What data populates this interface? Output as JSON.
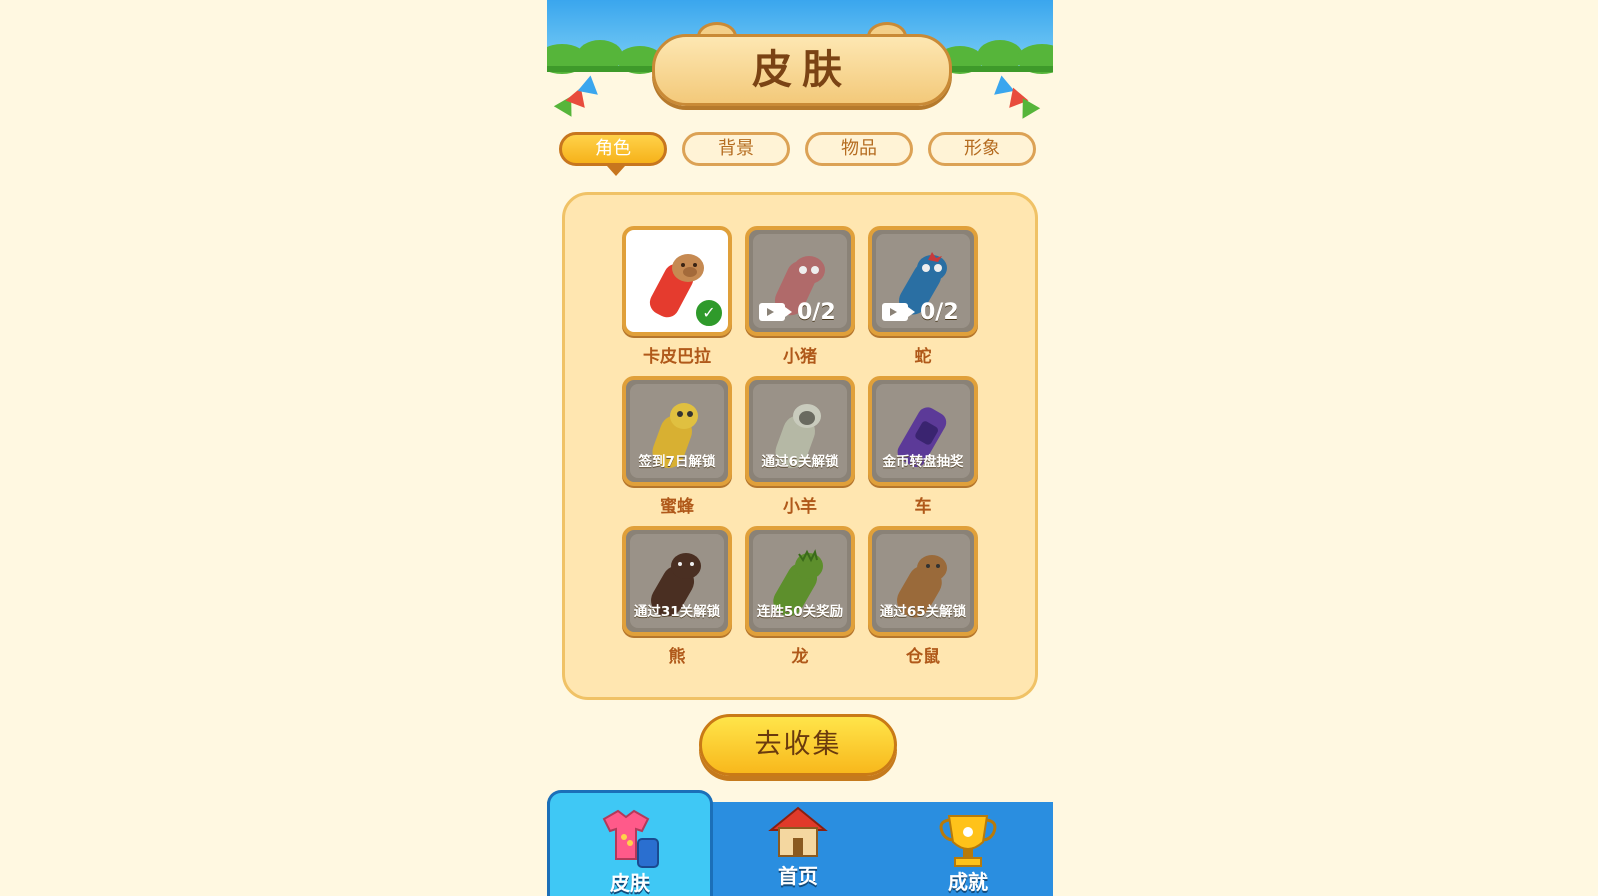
{
  "header": {
    "title": "皮肤"
  },
  "tabs": [
    {
      "label": "角色",
      "active": true
    },
    {
      "label": "背景",
      "active": false
    },
    {
      "label": "物品",
      "active": false
    },
    {
      "label": "形象",
      "active": false
    }
  ],
  "skins": [
    {
      "name": "卡皮巴拉",
      "status": "selected",
      "color": "#e53b2e",
      "head": "#c68a52"
    },
    {
      "name": "小猪",
      "progress": "0/2",
      "color": "#b06a6a",
      "head": "#b06a6a"
    },
    {
      "name": "蛇",
      "progress": "0/2",
      "color": "#2a6fa3",
      "head": "#2a6fa3"
    },
    {
      "name": "蜜蜂",
      "lock": "签到7日解锁",
      "color": "#d8b032",
      "head": "#e0c040"
    },
    {
      "name": "小羊",
      "lock": "通过6关解锁",
      "color": "#b5b8a5",
      "head": "#c9cbbd"
    },
    {
      "name": "车",
      "lock": "金币转盘抽奖",
      "color": "#5c3a98",
      "head": "#5c3a98"
    },
    {
      "name": "熊",
      "lock": "通过31关解锁",
      "color": "#4a2f22",
      "head": "#4a2f22"
    },
    {
      "name": "龙",
      "lock": "连胜50关奖励",
      "color": "#5d8f2c",
      "head": "#5d8f2c"
    },
    {
      "name": "仓鼠",
      "lock": "通过65关解锁",
      "color": "#9a6a3a",
      "head": "#9a6a3a"
    }
  ],
  "collect_button": "去收集",
  "nav": [
    {
      "label": "皮肤",
      "icon": "shirt-icon",
      "active": true
    },
    {
      "label": "首页",
      "icon": "house-icon",
      "active": false
    },
    {
      "label": "成就",
      "icon": "trophy-icon",
      "active": false
    }
  ]
}
